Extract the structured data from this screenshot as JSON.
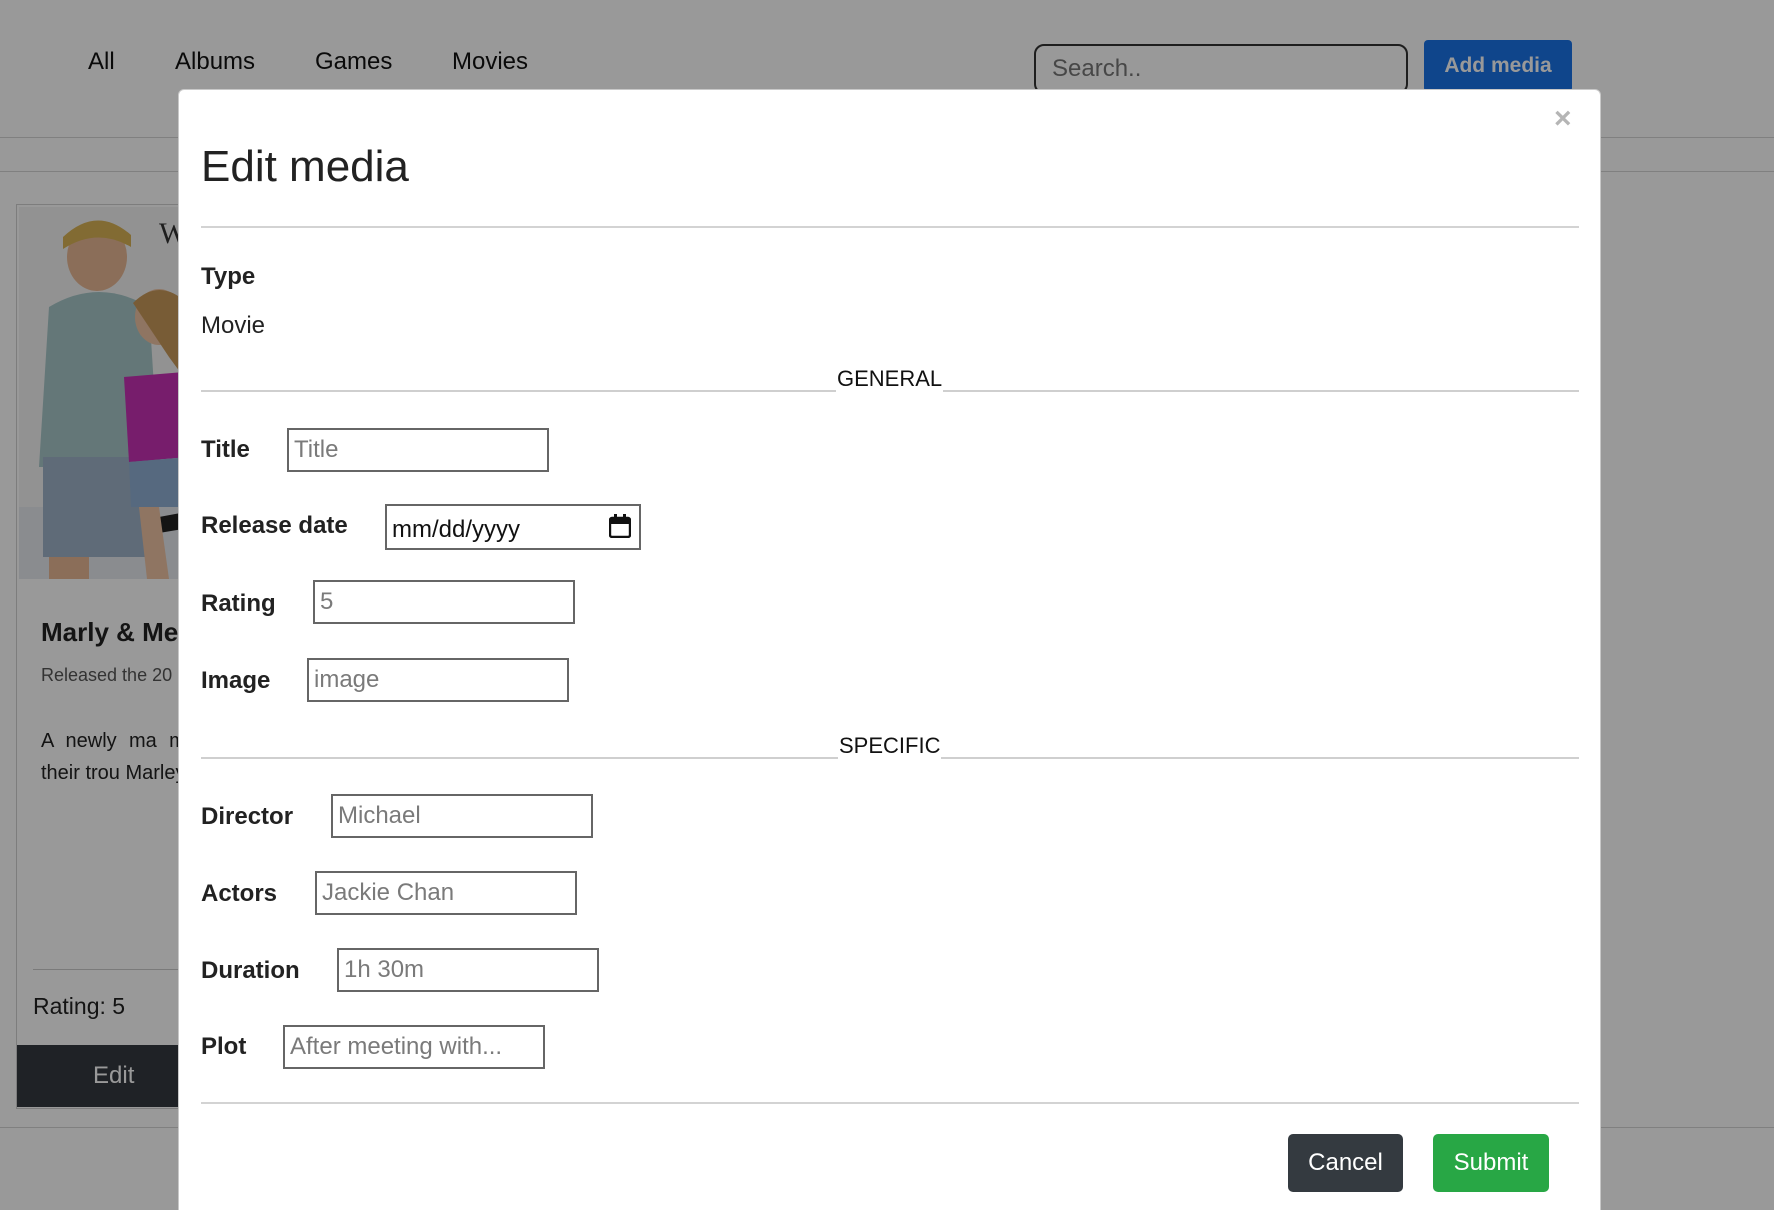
{
  "nav": {
    "tabs": [
      {
        "label": "All"
      },
      {
        "label": "Albums"
      },
      {
        "label": "Games"
      },
      {
        "label": "Movies"
      }
    ],
    "search_placeholder": "Search..",
    "add_button": "Add media"
  },
  "card": {
    "title": "Marly & Me",
    "release": "Released the 20",
    "description": "A newly ma many of life' from their trou Marley.",
    "rating": "Rating: 5",
    "edit_button": "Edit"
  },
  "modal": {
    "close_icon": "×",
    "title": "Edit media",
    "type_label": "Type",
    "type_value": "Movie",
    "general_section": "GENERAL",
    "specific_section": "SPECIFIC",
    "fields": {
      "title": {
        "label": "Title",
        "placeholder": "Title"
      },
      "release_date": {
        "label": "Release date",
        "value": "mm/dd/yyyy"
      },
      "rating": {
        "label": "Rating",
        "placeholder": "5"
      },
      "image": {
        "label": "Image",
        "placeholder": "image"
      },
      "director": {
        "label": "Director",
        "placeholder": "Michael"
      },
      "actors": {
        "label": "Actors",
        "placeholder": "Jackie Chan"
      },
      "duration": {
        "label": "Duration",
        "placeholder": "1h 30m"
      },
      "plot": {
        "label": "Plot",
        "placeholder": "After meeting with..."
      }
    },
    "cancel_button": "Cancel",
    "submit_button": "Submit"
  },
  "colors": {
    "primary": "#1a73e8",
    "dark": "#343a40",
    "success": "#28a745"
  }
}
